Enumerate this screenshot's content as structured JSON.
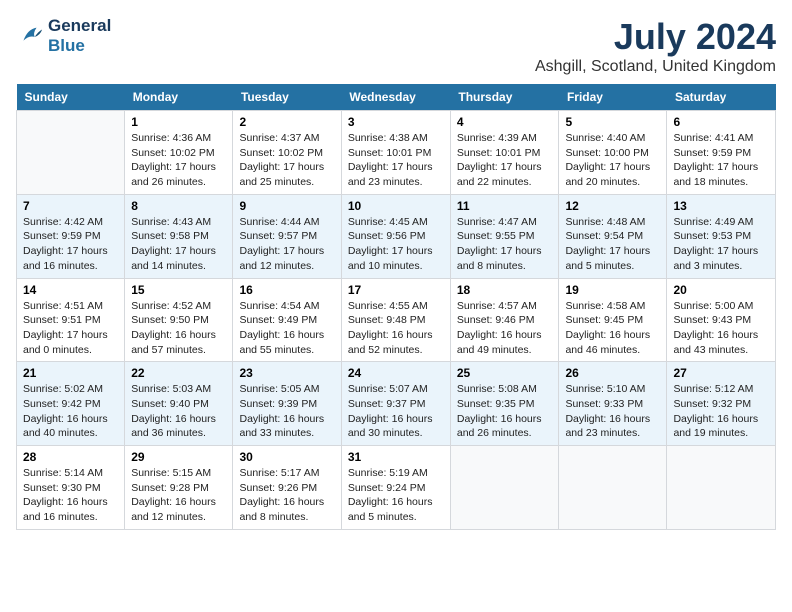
{
  "header": {
    "logo_line1": "General",
    "logo_line2": "Blue",
    "month_year": "July 2024",
    "location": "Ashgill, Scotland, United Kingdom"
  },
  "weekdays": [
    "Sunday",
    "Monday",
    "Tuesday",
    "Wednesday",
    "Thursday",
    "Friday",
    "Saturday"
  ],
  "weeks": [
    [
      {
        "day": "",
        "sunrise": "",
        "sunset": "",
        "daylight": ""
      },
      {
        "day": "1",
        "sunrise": "Sunrise: 4:36 AM",
        "sunset": "Sunset: 10:02 PM",
        "daylight": "Daylight: 17 hours and 26 minutes."
      },
      {
        "day": "2",
        "sunrise": "Sunrise: 4:37 AM",
        "sunset": "Sunset: 10:02 PM",
        "daylight": "Daylight: 17 hours and 25 minutes."
      },
      {
        "day": "3",
        "sunrise": "Sunrise: 4:38 AM",
        "sunset": "Sunset: 10:01 PM",
        "daylight": "Daylight: 17 hours and 23 minutes."
      },
      {
        "day": "4",
        "sunrise": "Sunrise: 4:39 AM",
        "sunset": "Sunset: 10:01 PM",
        "daylight": "Daylight: 17 hours and 22 minutes."
      },
      {
        "day": "5",
        "sunrise": "Sunrise: 4:40 AM",
        "sunset": "Sunset: 10:00 PM",
        "daylight": "Daylight: 17 hours and 20 minutes."
      },
      {
        "day": "6",
        "sunrise": "Sunrise: 4:41 AM",
        "sunset": "Sunset: 9:59 PM",
        "daylight": "Daylight: 17 hours and 18 minutes."
      }
    ],
    [
      {
        "day": "7",
        "sunrise": "Sunrise: 4:42 AM",
        "sunset": "Sunset: 9:59 PM",
        "daylight": "Daylight: 17 hours and 16 minutes."
      },
      {
        "day": "8",
        "sunrise": "Sunrise: 4:43 AM",
        "sunset": "Sunset: 9:58 PM",
        "daylight": "Daylight: 17 hours and 14 minutes."
      },
      {
        "day": "9",
        "sunrise": "Sunrise: 4:44 AM",
        "sunset": "Sunset: 9:57 PM",
        "daylight": "Daylight: 17 hours and 12 minutes."
      },
      {
        "day": "10",
        "sunrise": "Sunrise: 4:45 AM",
        "sunset": "Sunset: 9:56 PM",
        "daylight": "Daylight: 17 hours and 10 minutes."
      },
      {
        "day": "11",
        "sunrise": "Sunrise: 4:47 AM",
        "sunset": "Sunset: 9:55 PM",
        "daylight": "Daylight: 17 hours and 8 minutes."
      },
      {
        "day": "12",
        "sunrise": "Sunrise: 4:48 AM",
        "sunset": "Sunset: 9:54 PM",
        "daylight": "Daylight: 17 hours and 5 minutes."
      },
      {
        "day": "13",
        "sunrise": "Sunrise: 4:49 AM",
        "sunset": "Sunset: 9:53 PM",
        "daylight": "Daylight: 17 hours and 3 minutes."
      }
    ],
    [
      {
        "day": "14",
        "sunrise": "Sunrise: 4:51 AM",
        "sunset": "Sunset: 9:51 PM",
        "daylight": "Daylight: 17 hours and 0 minutes."
      },
      {
        "day": "15",
        "sunrise": "Sunrise: 4:52 AM",
        "sunset": "Sunset: 9:50 PM",
        "daylight": "Daylight: 16 hours and 57 minutes."
      },
      {
        "day": "16",
        "sunrise": "Sunrise: 4:54 AM",
        "sunset": "Sunset: 9:49 PM",
        "daylight": "Daylight: 16 hours and 55 minutes."
      },
      {
        "day": "17",
        "sunrise": "Sunrise: 4:55 AM",
        "sunset": "Sunset: 9:48 PM",
        "daylight": "Daylight: 16 hours and 52 minutes."
      },
      {
        "day": "18",
        "sunrise": "Sunrise: 4:57 AM",
        "sunset": "Sunset: 9:46 PM",
        "daylight": "Daylight: 16 hours and 49 minutes."
      },
      {
        "day": "19",
        "sunrise": "Sunrise: 4:58 AM",
        "sunset": "Sunset: 9:45 PM",
        "daylight": "Daylight: 16 hours and 46 minutes."
      },
      {
        "day": "20",
        "sunrise": "Sunrise: 5:00 AM",
        "sunset": "Sunset: 9:43 PM",
        "daylight": "Daylight: 16 hours and 43 minutes."
      }
    ],
    [
      {
        "day": "21",
        "sunrise": "Sunrise: 5:02 AM",
        "sunset": "Sunset: 9:42 PM",
        "daylight": "Daylight: 16 hours and 40 minutes."
      },
      {
        "day": "22",
        "sunrise": "Sunrise: 5:03 AM",
        "sunset": "Sunset: 9:40 PM",
        "daylight": "Daylight: 16 hours and 36 minutes."
      },
      {
        "day": "23",
        "sunrise": "Sunrise: 5:05 AM",
        "sunset": "Sunset: 9:39 PM",
        "daylight": "Daylight: 16 hours and 33 minutes."
      },
      {
        "day": "24",
        "sunrise": "Sunrise: 5:07 AM",
        "sunset": "Sunset: 9:37 PM",
        "daylight": "Daylight: 16 hours and 30 minutes."
      },
      {
        "day": "25",
        "sunrise": "Sunrise: 5:08 AM",
        "sunset": "Sunset: 9:35 PM",
        "daylight": "Daylight: 16 hours and 26 minutes."
      },
      {
        "day": "26",
        "sunrise": "Sunrise: 5:10 AM",
        "sunset": "Sunset: 9:33 PM",
        "daylight": "Daylight: 16 hours and 23 minutes."
      },
      {
        "day": "27",
        "sunrise": "Sunrise: 5:12 AM",
        "sunset": "Sunset: 9:32 PM",
        "daylight": "Daylight: 16 hours and 19 minutes."
      }
    ],
    [
      {
        "day": "28",
        "sunrise": "Sunrise: 5:14 AM",
        "sunset": "Sunset: 9:30 PM",
        "daylight": "Daylight: 16 hours and 16 minutes."
      },
      {
        "day": "29",
        "sunrise": "Sunrise: 5:15 AM",
        "sunset": "Sunset: 9:28 PM",
        "daylight": "Daylight: 16 hours and 12 minutes."
      },
      {
        "day": "30",
        "sunrise": "Sunrise: 5:17 AM",
        "sunset": "Sunset: 9:26 PM",
        "daylight": "Daylight: 16 hours and 8 minutes."
      },
      {
        "day": "31",
        "sunrise": "Sunrise: 5:19 AM",
        "sunset": "Sunset: 9:24 PM",
        "daylight": "Daylight: 16 hours and 5 minutes."
      },
      {
        "day": "",
        "sunrise": "",
        "sunset": "",
        "daylight": ""
      },
      {
        "day": "",
        "sunrise": "",
        "sunset": "",
        "daylight": ""
      },
      {
        "day": "",
        "sunrise": "",
        "sunset": "",
        "daylight": ""
      }
    ]
  ]
}
